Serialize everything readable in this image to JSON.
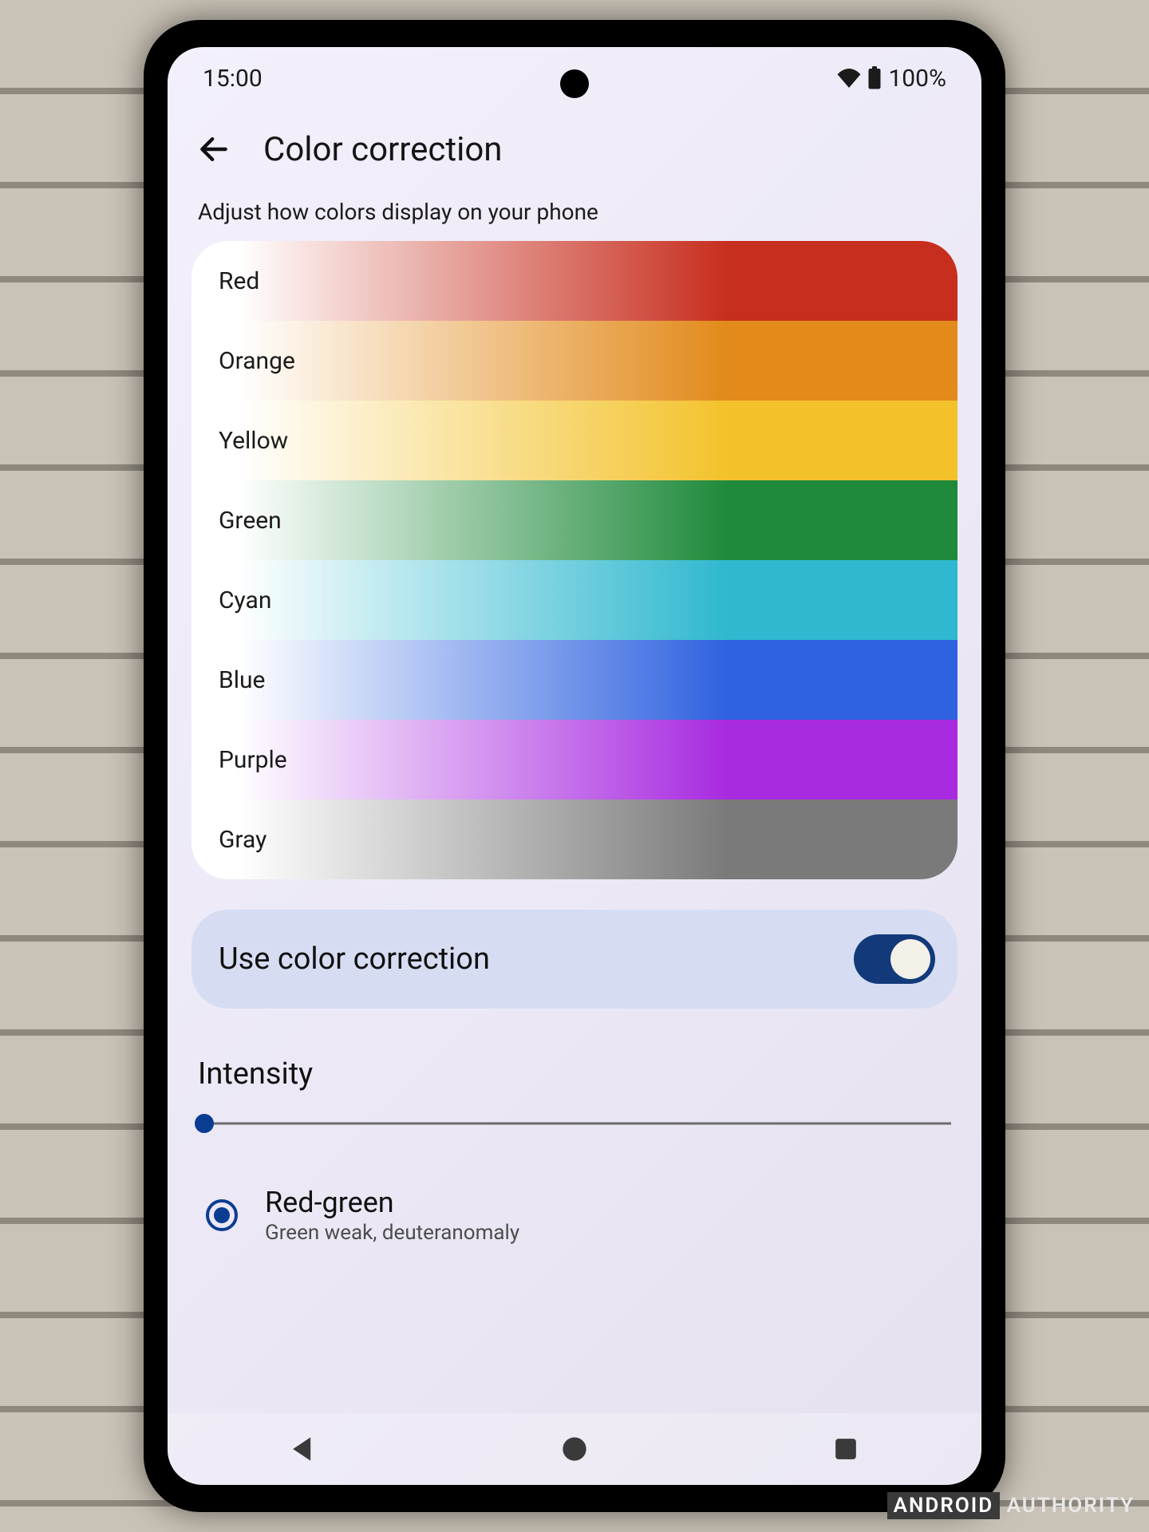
{
  "watermark": {
    "left": "ANDROID",
    "right": "AUTHORITY"
  },
  "status": {
    "time": "15:00",
    "battery": "100%"
  },
  "header": {
    "title": "Color correction"
  },
  "subtitle": "Adjust how colors display on your phone",
  "swatches": [
    {
      "label": "Red",
      "color": "#c72e1e"
    },
    {
      "label": "Orange",
      "color": "#e28a1a"
    },
    {
      "label": "Yellow",
      "color": "#f3c22b"
    },
    {
      "label": "Green",
      "color": "#1f8a3b"
    },
    {
      "label": "Cyan",
      "color": "#2fb8cf"
    },
    {
      "label": "Blue",
      "color": "#2f62e0"
    },
    {
      "label": "Purple",
      "color": "#a82be0"
    },
    {
      "label": "Gray",
      "color": "#7a7a7a"
    }
  ],
  "toggle": {
    "label": "Use color correction",
    "on": true
  },
  "intensity": {
    "label": "Intensity",
    "value": 0
  },
  "option": {
    "selected": true,
    "primary": "Red-green",
    "secondary": "Green weak, deuteranomaly"
  }
}
